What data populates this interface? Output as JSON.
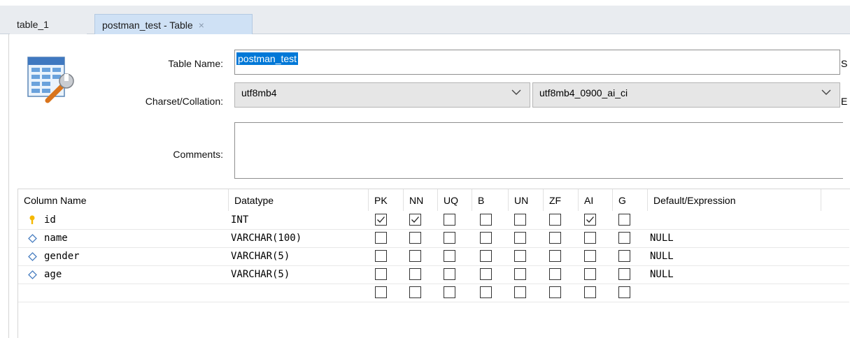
{
  "tabs": [
    {
      "label": "table_1",
      "active": false
    },
    {
      "label": "postman_test - Table",
      "active": true,
      "close_glyph": "×"
    }
  ],
  "form": {
    "table_name_label": "Table Name:",
    "table_name_value": "postman_test",
    "charset_label": "Charset/Collation:",
    "charset_value": "utf8mb4",
    "collation_value": "utf8mb4_0900_ai_ci",
    "comments_label": "Comments:",
    "comments_value": "",
    "right_edge_letters": [
      "S",
      "E"
    ],
    "icon": "table-editor-icon"
  },
  "columns_header": [
    "Column Name",
    "Datatype",
    "PK",
    "NN",
    "UQ",
    "B",
    "UN",
    "ZF",
    "AI",
    "G",
    "Default/Expression"
  ],
  "rows": [
    {
      "name": "id",
      "icon": "primary-key-icon",
      "datatype": "INT",
      "flags": [
        true,
        true,
        false,
        false,
        false,
        false,
        true,
        false
      ],
      "default": ""
    },
    {
      "name": "name",
      "icon": "column-diamond-icon",
      "datatype": "VARCHAR(100)",
      "flags": [
        false,
        false,
        false,
        false,
        false,
        false,
        false,
        false
      ],
      "default": "NULL"
    },
    {
      "name": "gender",
      "icon": "column-diamond-icon",
      "datatype": "VARCHAR(5)",
      "flags": [
        false,
        false,
        false,
        false,
        false,
        false,
        false,
        false
      ],
      "default": "NULL"
    },
    {
      "name": "age",
      "icon": "column-diamond-icon",
      "datatype": "VARCHAR(5)",
      "flags": [
        false,
        false,
        false,
        false,
        false,
        false,
        false,
        false
      ],
      "default": "NULL"
    },
    {
      "name": "",
      "icon": "",
      "datatype": "",
      "flags": [
        false,
        false,
        false,
        false,
        false,
        false,
        false,
        false
      ],
      "default": ""
    }
  ],
  "colors": {
    "selection": "#0078d7",
    "active_tab": "#cfe1f5",
    "tabbar": "#e9ecf0",
    "key_icon": "#f5b800",
    "diamond_icon": "#4a7fc1"
  }
}
